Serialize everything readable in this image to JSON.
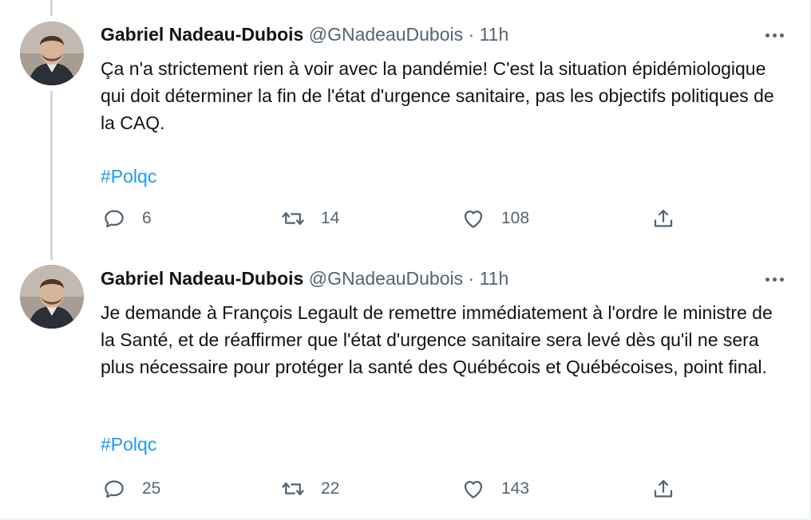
{
  "colors": {
    "text": "#0f1419",
    "secondary": "#536471",
    "link": "#1d9bf0",
    "thread_line": "#cfd9de"
  },
  "icons": {
    "reply": "reply-bubble-icon",
    "retweet": "retweet-arrows-icon",
    "like": "heart-icon",
    "share": "share-upload-icon",
    "more": "more-dots-icon"
  },
  "tweets": [
    {
      "author": "Gabriel Nadeau-Dubois",
      "handle": "@GNadeauDubois",
      "separator": "·",
      "time": "11h",
      "text": "Ça n'a strictement rien à voir avec la pandémie! C'est la situation épidémiologique qui doit déterminer la fin de l'état d'urgence sanitaire, pas les objectifs politiques de la CAQ.",
      "hashtag": "#Polqc",
      "replies": "6",
      "retweets": "14",
      "likes": "108"
    },
    {
      "author": "Gabriel Nadeau-Dubois",
      "handle": "@GNadeauDubois",
      "separator": "·",
      "time": "11h",
      "text": "Je demande à François Legault de remettre immédiatement à l'ordre le ministre de la Santé, et de réaffirmer que l'état d'urgence sanitaire sera levé dès qu'il ne sera plus nécessaire pour protéger la santé des Québécois et Québécoises, point final.",
      "hashtag": "#Polqc",
      "replies": "25",
      "retweets": "22",
      "likes": "143"
    }
  ]
}
